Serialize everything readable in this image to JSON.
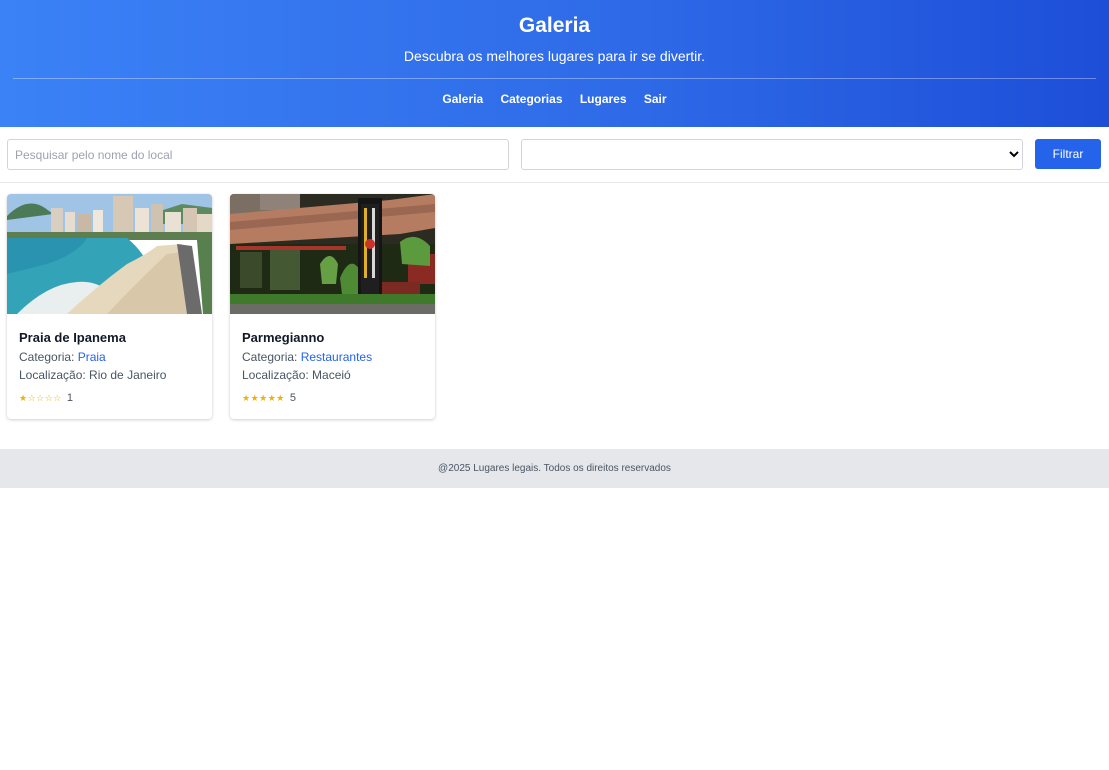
{
  "header": {
    "title": "Galeria",
    "subtitle": "Descubra os melhores lugares para ir se divertir."
  },
  "nav": {
    "items": [
      "Galeria",
      "Categorias",
      "Lugares",
      "Sair"
    ]
  },
  "filters": {
    "search_placeholder": "Pesquisar pelo nome do local",
    "select_value": "",
    "button_label": "Filtrar"
  },
  "cards": [
    {
      "title": "Praia de Ipanema",
      "category_label": "Categoria: ",
      "category": "Praia",
      "location_label": "Localização: ",
      "location": "Rio de Janeiro",
      "stars": "★☆☆☆☆",
      "rating": "1",
      "image": "beach-photo"
    },
    {
      "title": "Parmegianno",
      "category_label": "Categoria: ",
      "category": "Restaurantes",
      "location_label": "Localização: ",
      "location": "Maceió",
      "stars": "★★★★★",
      "rating": "5",
      "image": "restaurant-photo"
    }
  ],
  "footer": {
    "text": "@2025 Lugares legais. Todos os direitos reservados"
  },
  "colors": {
    "header_gradient_start": "#3b82f6",
    "header_gradient_end": "#1d4ed8",
    "accent": "#2563eb",
    "star": "#eab308",
    "footer_bg": "#e5e7eb"
  }
}
